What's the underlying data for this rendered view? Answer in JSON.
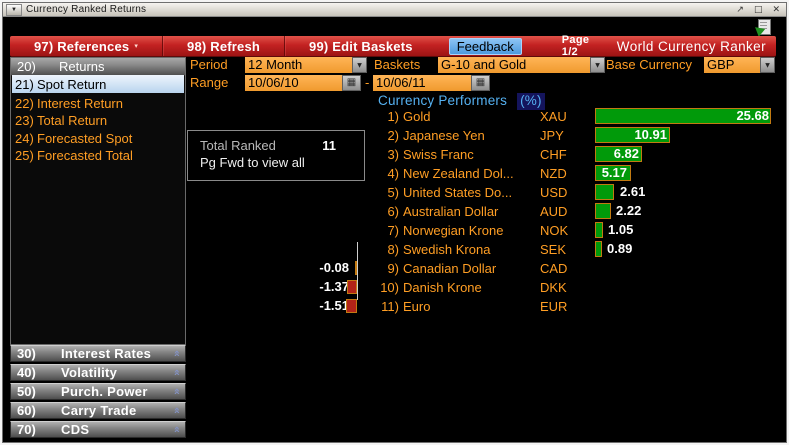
{
  "window": {
    "title": "Currency Ranked Returns"
  },
  "icons": {
    "dropdown": "▼",
    "menu_caret": "▾",
    "calendar": "▦",
    "chevron_double": "»",
    "window_popout": "↗",
    "window_maximize": "□",
    "window_close": "✕"
  },
  "colors": {
    "amber_field": "#f09a2e",
    "orange_text": "#ff9e24",
    "header_blue": "#55b1f1",
    "bar_green": "#019a0a",
    "bar_red": "#b22318",
    "menu_red": "#c32222",
    "feedback_blue": "#5ba7e8"
  },
  "menubar": {
    "references_label": "97) References",
    "refresh_label": "98) Refresh",
    "edit_baskets_label": "99) Edit Baskets",
    "feedback_label": "Feedback",
    "page_indicator": "Page 1/2",
    "app_title": "World Currency Ranker"
  },
  "controls": {
    "period_label": "Period",
    "period_value": "12 Month",
    "baskets_label": "Baskets",
    "baskets_value": "G-10 and Gold",
    "base_currency_label": "Base Currency",
    "base_currency_value": "GBP",
    "range_label": "Range",
    "range_start": "10/06/10",
    "range_separator": "-",
    "range_end": "10/06/11"
  },
  "sidebar": {
    "header": {
      "num": "20)",
      "label": "Returns"
    },
    "items": [
      {
        "num": "21)",
        "label": "Spot Return",
        "selected": true
      },
      {
        "num": "22)",
        "label": "Interest Return"
      },
      {
        "num": "23)",
        "label": "Total Return"
      },
      {
        "num": "24)",
        "label": "Forecasted Spot"
      },
      {
        "num": "25)",
        "label": "Forecasted Total"
      }
    ],
    "bottom_items": [
      {
        "num": "30)",
        "label": "Interest Rates"
      },
      {
        "num": "40)",
        "label": "Volatility"
      },
      {
        "num": "50)",
        "label": "Purch. Power"
      },
      {
        "num": "60)",
        "label": "Carry Trade"
      },
      {
        "num": "70)",
        "label": "CDS"
      }
    ]
  },
  "main": {
    "summary": {
      "label": "Total Ranked",
      "value": "11",
      "note": "Pg Fwd to view all"
    },
    "list_header": {
      "title": "Currency Performers",
      "unit": "(%)"
    },
    "rows": [
      {
        "num": "1)",
        "name": "Gold",
        "ticker": "XAU",
        "value": "25.68"
      },
      {
        "num": "2)",
        "name": "Japanese Yen",
        "ticker": "JPY",
        "value": "10.91"
      },
      {
        "num": "3)",
        "name": "Swiss Franc",
        "ticker": "CHF",
        "value": "6.82"
      },
      {
        "num": "4)",
        "name": "New Zealand Dol...",
        "ticker": "NZD",
        "value": "5.17"
      },
      {
        "num": "5)",
        "name": "United States Do...",
        "ticker": "USD",
        "value": "2.61"
      },
      {
        "num": "6)",
        "name": "Australian Dollar",
        "ticker": "AUD",
        "value": "2.22"
      },
      {
        "num": "7)",
        "name": "Norwegian Krone",
        "ticker": "NOK",
        "value": "1.05"
      },
      {
        "num": "8)",
        "name": "Swedish Krona",
        "ticker": "SEK",
        "value": "0.89"
      },
      {
        "num": "9)",
        "name": "Canadian Dollar",
        "ticker": "CAD",
        "value": "-0.08"
      },
      {
        "num": "10)",
        "name": "Danish Krone",
        "ticker": "DKK",
        "value": "-1.37"
      },
      {
        "num": "11)",
        "name": "Euro",
        "ticker": "EUR",
        "value": "-1.51"
      }
    ]
  },
  "chart_data": {
    "type": "bar",
    "orientation": "horizontal",
    "title": "Currency Performers (%)",
    "categories": [
      "Gold",
      "Japanese Yen",
      "Swiss Franc",
      "New Zealand Dollar",
      "United States Dollar",
      "Australian Dollar",
      "Norwegian Krone",
      "Swedish Krona",
      "Canadian Dollar",
      "Danish Krone",
      "Euro"
    ],
    "tickers": [
      "XAU",
      "JPY",
      "CHF",
      "NZD",
      "USD",
      "AUD",
      "NOK",
      "SEK",
      "CAD",
      "DKK",
      "EUR"
    ],
    "values": [
      25.68,
      10.91,
      6.82,
      5.17,
      2.61,
      2.22,
      1.05,
      0.89,
      -0.08,
      -1.37,
      -1.51
    ],
    "unit": "%",
    "positive_color": "#019a0a",
    "negative_color": "#b22318"
  }
}
